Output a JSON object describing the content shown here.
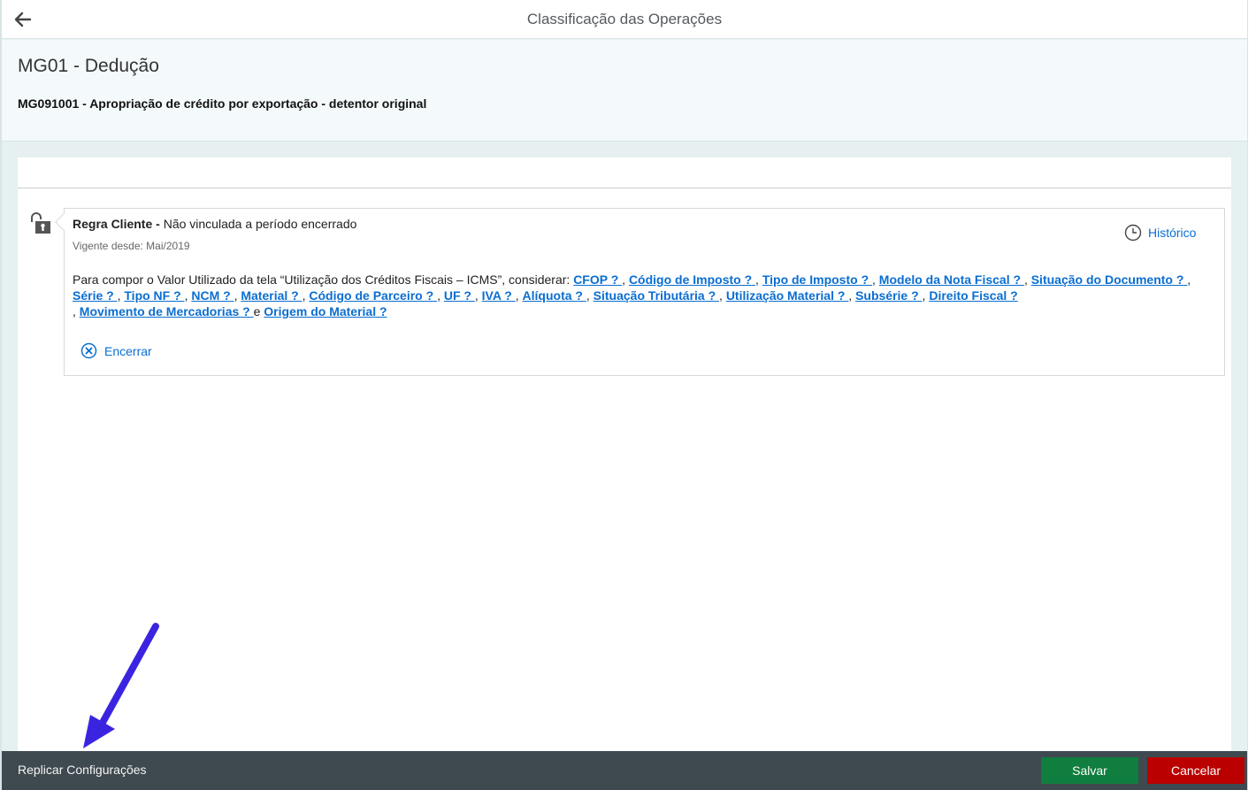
{
  "header": {
    "title": "Classificação das Operações"
  },
  "object": {
    "title": "MG01 - Dedução",
    "subtitle": "MG091001 - Apropriação de crédito por exportação - detentor original"
  },
  "rule": {
    "label": "Regra Cliente -",
    "status": " Não vinculada a período encerrado",
    "vigente": "Vigente desde: Mai/2019",
    "historico": "Histórico",
    "intro": "Para compor o Valor Utilizado da tela “Utilização dos Créditos Fiscais – ICMS”, considerar: ",
    "links": [
      "CFOP ? ",
      "Código de Imposto ? ",
      "Tipo de Imposto ? ",
      "Modelo da Nota Fiscal ? ",
      "Situação do Documento ? ",
      "Série ? ",
      "Tipo NF ? ",
      "NCM ? ",
      "Material ? ",
      "Código de Parceiro ? ",
      "UF ? ",
      "IVA ? ",
      "Alíquota ? ",
      "Situação Tributária ? ",
      "Utilização Material ? ",
      "Subsérie ? ",
      "Direito Fiscal ? ",
      "Movimento de Mercadorias ? ",
      "Origem do Material ?"
    ],
    "sep": ", ",
    "conj": "e ",
    "encerrar": "Encerrar"
  },
  "footer": {
    "replicar": "Replicar Configurações",
    "salvar": "Salvar",
    "cancelar": "Cancelar"
  },
  "colors": {
    "link": "#0a6ed1",
    "save": "#107e3e",
    "cancel": "#bb0000",
    "footer_bg": "#3f4a50",
    "annotation_arrow": "#3b24e0"
  },
  "icons": {
    "back": "arrow-left-icon",
    "lock": "unlocked-padlock-icon",
    "history": "clock-icon",
    "close": "circle-x-icon"
  }
}
